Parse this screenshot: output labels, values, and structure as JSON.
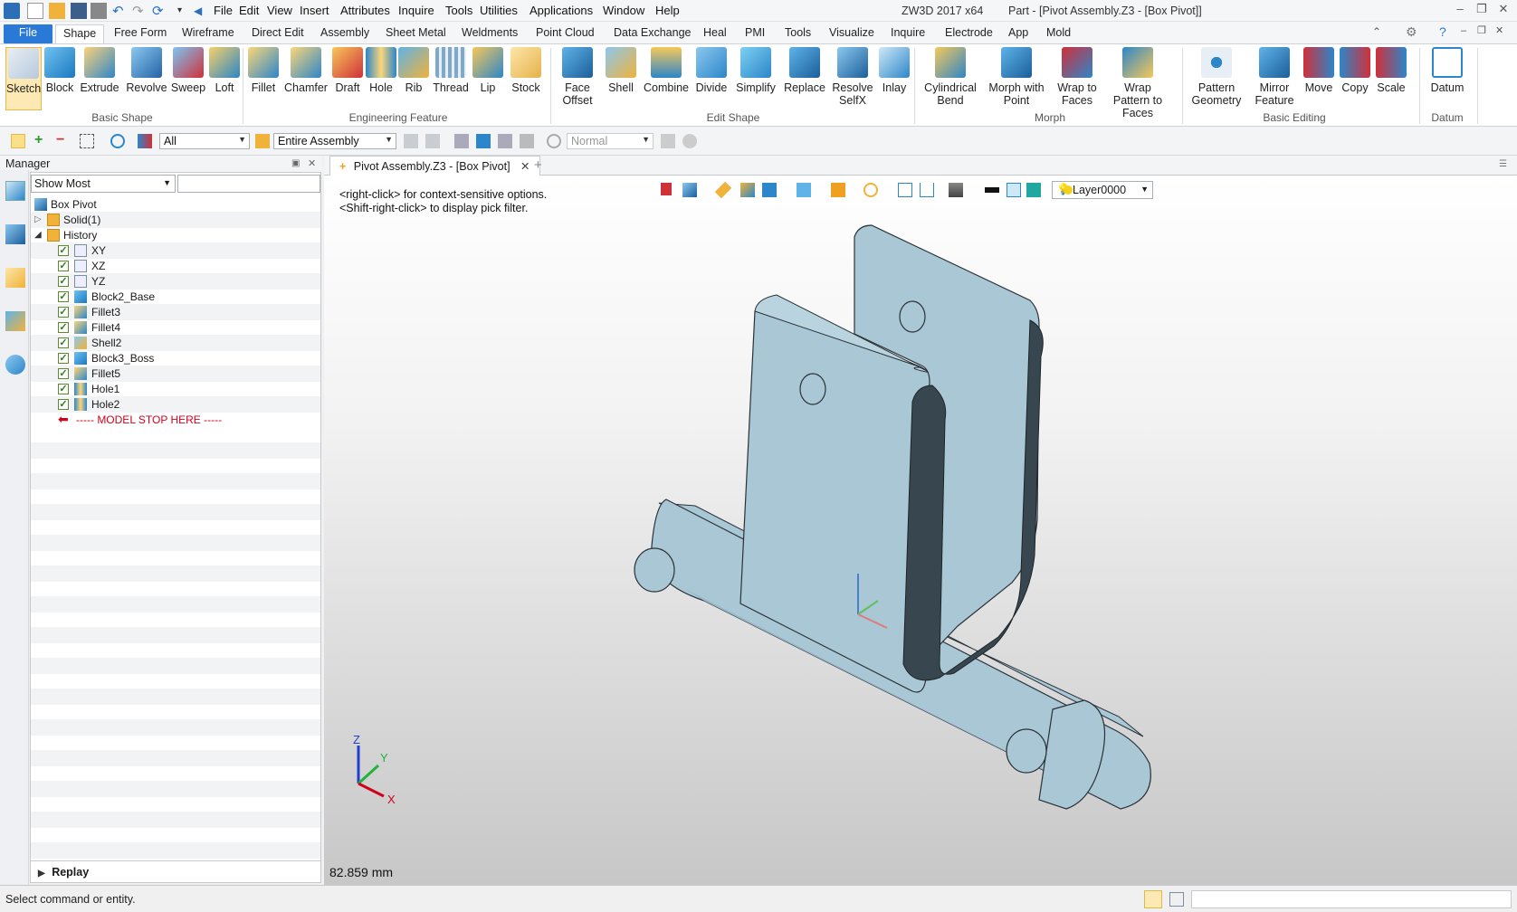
{
  "title_bar": {
    "menus": [
      "File",
      "Edit",
      "View",
      "Insert",
      "Attributes",
      "Inquire",
      "Tools",
      "Utilities",
      "Applications",
      "Window",
      "Help"
    ],
    "app_name": "ZW3D 2017  x64",
    "document_title": "Part - [Pivot Assembly.Z3 - [Box Pivot]]"
  },
  "ribbon_tabs": [
    "File",
    "Shape",
    "Free Form",
    "Wireframe",
    "Direct Edit",
    "Assembly",
    "Sheet Metal",
    "Weldments",
    "Point Cloud",
    "Data Exchange",
    "Heal",
    "PMI",
    "Tools",
    "Visualize",
    "Inquire",
    "Electrode",
    "App",
    "Mold"
  ],
  "ribbon_groups": {
    "basic_shape": {
      "label": "Basic Shape",
      "buttons": [
        "Sketch",
        "Block",
        "Extrude",
        "Revolve",
        "Sweep",
        "Loft"
      ]
    },
    "engineering_feature": {
      "label": "Engineering Feature",
      "buttons": [
        "Fillet",
        "Chamfer",
        "Draft",
        "Hole",
        "Rib",
        "Thread",
        "Lip",
        "Stock"
      ]
    },
    "edit_shape": {
      "label": "Edit Shape",
      "buttons": [
        "Face Offset",
        "Shell",
        "Combine",
        "Divide",
        "Simplify",
        "Replace",
        "Resolve SelfX",
        "Inlay"
      ]
    },
    "morph": {
      "label": "Morph",
      "buttons": [
        "Cylindrical Bend",
        "Morph with Point",
        "Wrap to Faces",
        "Wrap Pattern to Faces"
      ]
    },
    "basic_editing": {
      "label": "Basic Editing",
      "buttons": [
        "Pattern Geometry",
        "Mirror Feature",
        "Move",
        "Copy",
        "Scale"
      ]
    },
    "datum": {
      "label": "Datum",
      "buttons": [
        "Datum"
      ]
    }
  },
  "toolbar": {
    "filter_value": "All",
    "scope_value": "Entire Assembly",
    "mode_value": "Normal"
  },
  "manager": {
    "title": "Manager",
    "show_value": "Show Most",
    "tree": {
      "root": "Box Pivot",
      "solid": "Solid(1)",
      "history": "History",
      "items": [
        "XY",
        "XZ",
        "YZ",
        "Block2_Base",
        "Fillet3",
        "Fillet4",
        "Shell2",
        "Block3_Boss",
        "Fillet5",
        "Hole1",
        "Hole2"
      ],
      "stop_marker": "----- MODEL STOP HERE -----"
    },
    "replay": "Replay"
  },
  "document_tab": "Pivot Assembly.Z3 - [Box Pivot]",
  "viewport": {
    "hint1": "<right-click> for context-sensitive options.",
    "hint2": "<Shift-right-click> to display pick filter.",
    "layer": "Layer0000",
    "measure": "82.859 mm",
    "axis_x": "X",
    "axis_y": "Y",
    "axis_z": "Z"
  },
  "status": "Select command or entity.",
  "colors": {
    "accent": "#2b79d7",
    "part_fill": "#a9c7d4",
    "part_dark": "#3a4a53",
    "stop_marker": "#d0021b"
  }
}
